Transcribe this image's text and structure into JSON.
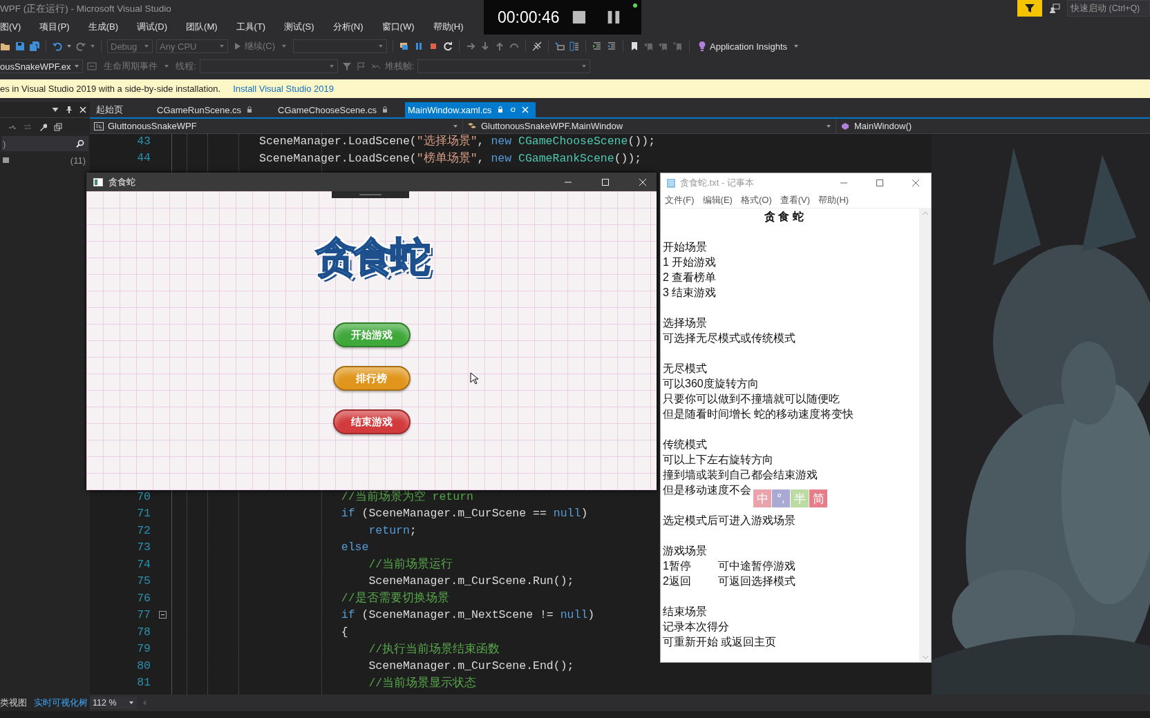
{
  "vs": {
    "title": "WPF (正在运行) - Microsoft Visual Studio",
    "quick_launch": {
      "placeholder": "快速启动 (Ctrl+Q)"
    },
    "menu": [
      "图(V)",
      "项目(P)",
      "生成(B)",
      "调试(D)",
      "团队(M)",
      "工具(T)",
      "测试(S)",
      "分析(N)",
      "窗口(W)",
      "帮助(H)"
    ],
    "toolbar": {
      "config": "Debug",
      "platform": "Any CPU",
      "continue": "继续(C)",
      "insights": "Application Insights"
    },
    "debug_location": {
      "process": "ousSnakeWPF.ex",
      "lifecycle": "生命周期事件",
      "thread_label": "线程:",
      "stack_label": "堆栈帧:"
    },
    "info_bar": {
      "message": "es in Visual Studio 2019 with a side-by-side installation.",
      "link": "Install Visual Studio 2019"
    },
    "left_panel": {
      "search_value": ")",
      "count": "(11)",
      "tabs": [
        {
          "label": "类视图",
          "selected": false
        },
        {
          "label": "实时可视化树",
          "selected": true
        }
      ]
    },
    "editor_tabs": [
      {
        "label": "起始页",
        "selected": false,
        "locked": false
      },
      {
        "label": "CGameRunScene.cs",
        "selected": false,
        "locked": true
      },
      {
        "label": "CGameChooseScene.cs",
        "selected": false,
        "locked": true
      },
      {
        "label": "MainWindow.xaml.cs",
        "selected": true,
        "locked": true
      }
    ],
    "nav": {
      "project": "GluttonousSnakeWPF",
      "type": "GluttonousSnakeWPF.MainWindow",
      "member": "MainWindow()"
    },
    "code_blocks": [
      [
        {
          "num": "43",
          "tokens": [
            {
              "kind": "plain",
              "text": "SceneManager.LoadScene("
            },
            {
              "kind": "string",
              "text": "\"选择场景\""
            },
            {
              "kind": "plain",
              "text": ", "
            },
            {
              "kind": "keyword",
              "text": "new"
            },
            {
              "kind": "type",
              "text": " CGameChooseScene"
            },
            {
              "kind": "plain",
              "text": "());"
            }
          ]
        },
        {
          "num": "44",
          "tokens": [
            {
              "kind": "plain",
              "text": "SceneManager.LoadScene("
            },
            {
              "kind": "string",
              "text": "\"榜单场景\""
            },
            {
              "kind": "plain",
              "text": ", "
            },
            {
              "kind": "keyword",
              "text": "new"
            },
            {
              "kind": "type",
              "text": " CGameRankScene"
            },
            {
              "kind": "plain",
              "text": "());"
            }
          ]
        }
      ],
      [
        {
          "num": "70",
          "tokens": [
            {
              "kind": "comment",
              "text": "            //当前场景为空 return"
            }
          ]
        },
        {
          "num": "71",
          "tokens": [
            {
              "kind": "keyword",
              "text": "            if"
            },
            {
              "kind": "plain",
              "text": " (SceneManager.m_CurScene == "
            },
            {
              "kind": "keyword",
              "text": "null"
            },
            {
              "kind": "plain",
              "text": ")"
            }
          ]
        },
        {
          "num": "72",
          "tokens": [
            {
              "kind": "keyword",
              "text": "                return"
            },
            {
              "kind": "plain",
              "text": ";"
            }
          ]
        },
        {
          "num": "73",
          "tokens": [
            {
              "kind": "keyword",
              "text": "            else"
            }
          ]
        },
        {
          "num": "74",
          "tokens": [
            {
              "kind": "comment",
              "text": "                //当前场景运行"
            }
          ]
        },
        {
          "num": "75",
          "tokens": [
            {
              "kind": "plain",
              "text": "                SceneManager.m_CurScene.Run();"
            }
          ]
        },
        {
          "num": "76",
          "tokens": [
            {
              "kind": "comment",
              "text": "            //是否需要切换场景"
            }
          ]
        },
        {
          "num": "77",
          "fold": true,
          "tokens": [
            {
              "kind": "keyword",
              "text": "            if"
            },
            {
              "kind": "plain",
              "text": " (SceneManager.m_NextScene != "
            },
            {
              "kind": "keyword",
              "text": "null"
            },
            {
              "kind": "plain",
              "text": ")"
            }
          ]
        },
        {
          "num": "78",
          "tokens": [
            {
              "kind": "plain",
              "text": "            {"
            }
          ]
        },
        {
          "num": "79",
          "tokens": [
            {
              "kind": "comment",
              "text": "                //执行当前场景结束函数"
            }
          ]
        },
        {
          "num": "80",
          "tokens": [
            {
              "kind": "plain",
              "text": "                SceneManager.m_CurScene.End();"
            }
          ]
        },
        {
          "num": "81",
          "tokens": [
            {
              "kind": "comment",
              "text": "                //当前场景显示状态"
            }
          ]
        }
      ]
    ],
    "zoom": "112 %"
  },
  "recorder": {
    "time": "00:00:46"
  },
  "game_window": {
    "title": "贪食蛇",
    "logo": "贪食蛇",
    "buttons": [
      {
        "label": "开始游戏",
        "color": "#3fa83a"
      },
      {
        "label": "排行榜",
        "color": "#e0961c"
      },
      {
        "label": "结束游戏",
        "color": "#d23a3c"
      }
    ]
  },
  "notepad": {
    "title": "贪食蛇.txt - 记事本",
    "menu": [
      "文件(F)",
      "编辑(E)",
      "格式(O)",
      "查看(V)",
      "帮助(H)"
    ],
    "heading": "贪 食 蛇",
    "paragraphs": [
      [
        "开始场景",
        "1 开始游戏",
        "2 查看榜单",
        "3 结束游戏"
      ],
      [
        "选择场景",
        "可选择无尽模式或传统模式"
      ],
      [
        "无尽模式",
        "可以360度旋转方向",
        "只要你可以做到不撞墙就可以随便吃",
        "但是随看时间增长 蛇的移动速度将变快"
      ],
      [
        "传统模式",
        "可以上下左右旋转方向",
        "撞到墙或装到自己都会结束游戏",
        "但是移动速度不会"
      ],
      [
        "选定模式后可进入游戏场景"
      ],
      [
        "游戏场景",
        "1暂停\t可中途暂停游戏",
        "2返回\t可返回选择模式"
      ],
      [
        "结束场景",
        "记录本次得分",
        "可重新开始 或返回主页"
      ]
    ]
  },
  "ime_bar": [
    {
      "label": "中",
      "color": "#e9a3ab"
    },
    {
      "label": "°,",
      "color": "#a9a9d4"
    },
    {
      "label": "半",
      "color": "#bcdba3"
    },
    {
      "label": "简",
      "color": "#e67d88"
    }
  ]
}
